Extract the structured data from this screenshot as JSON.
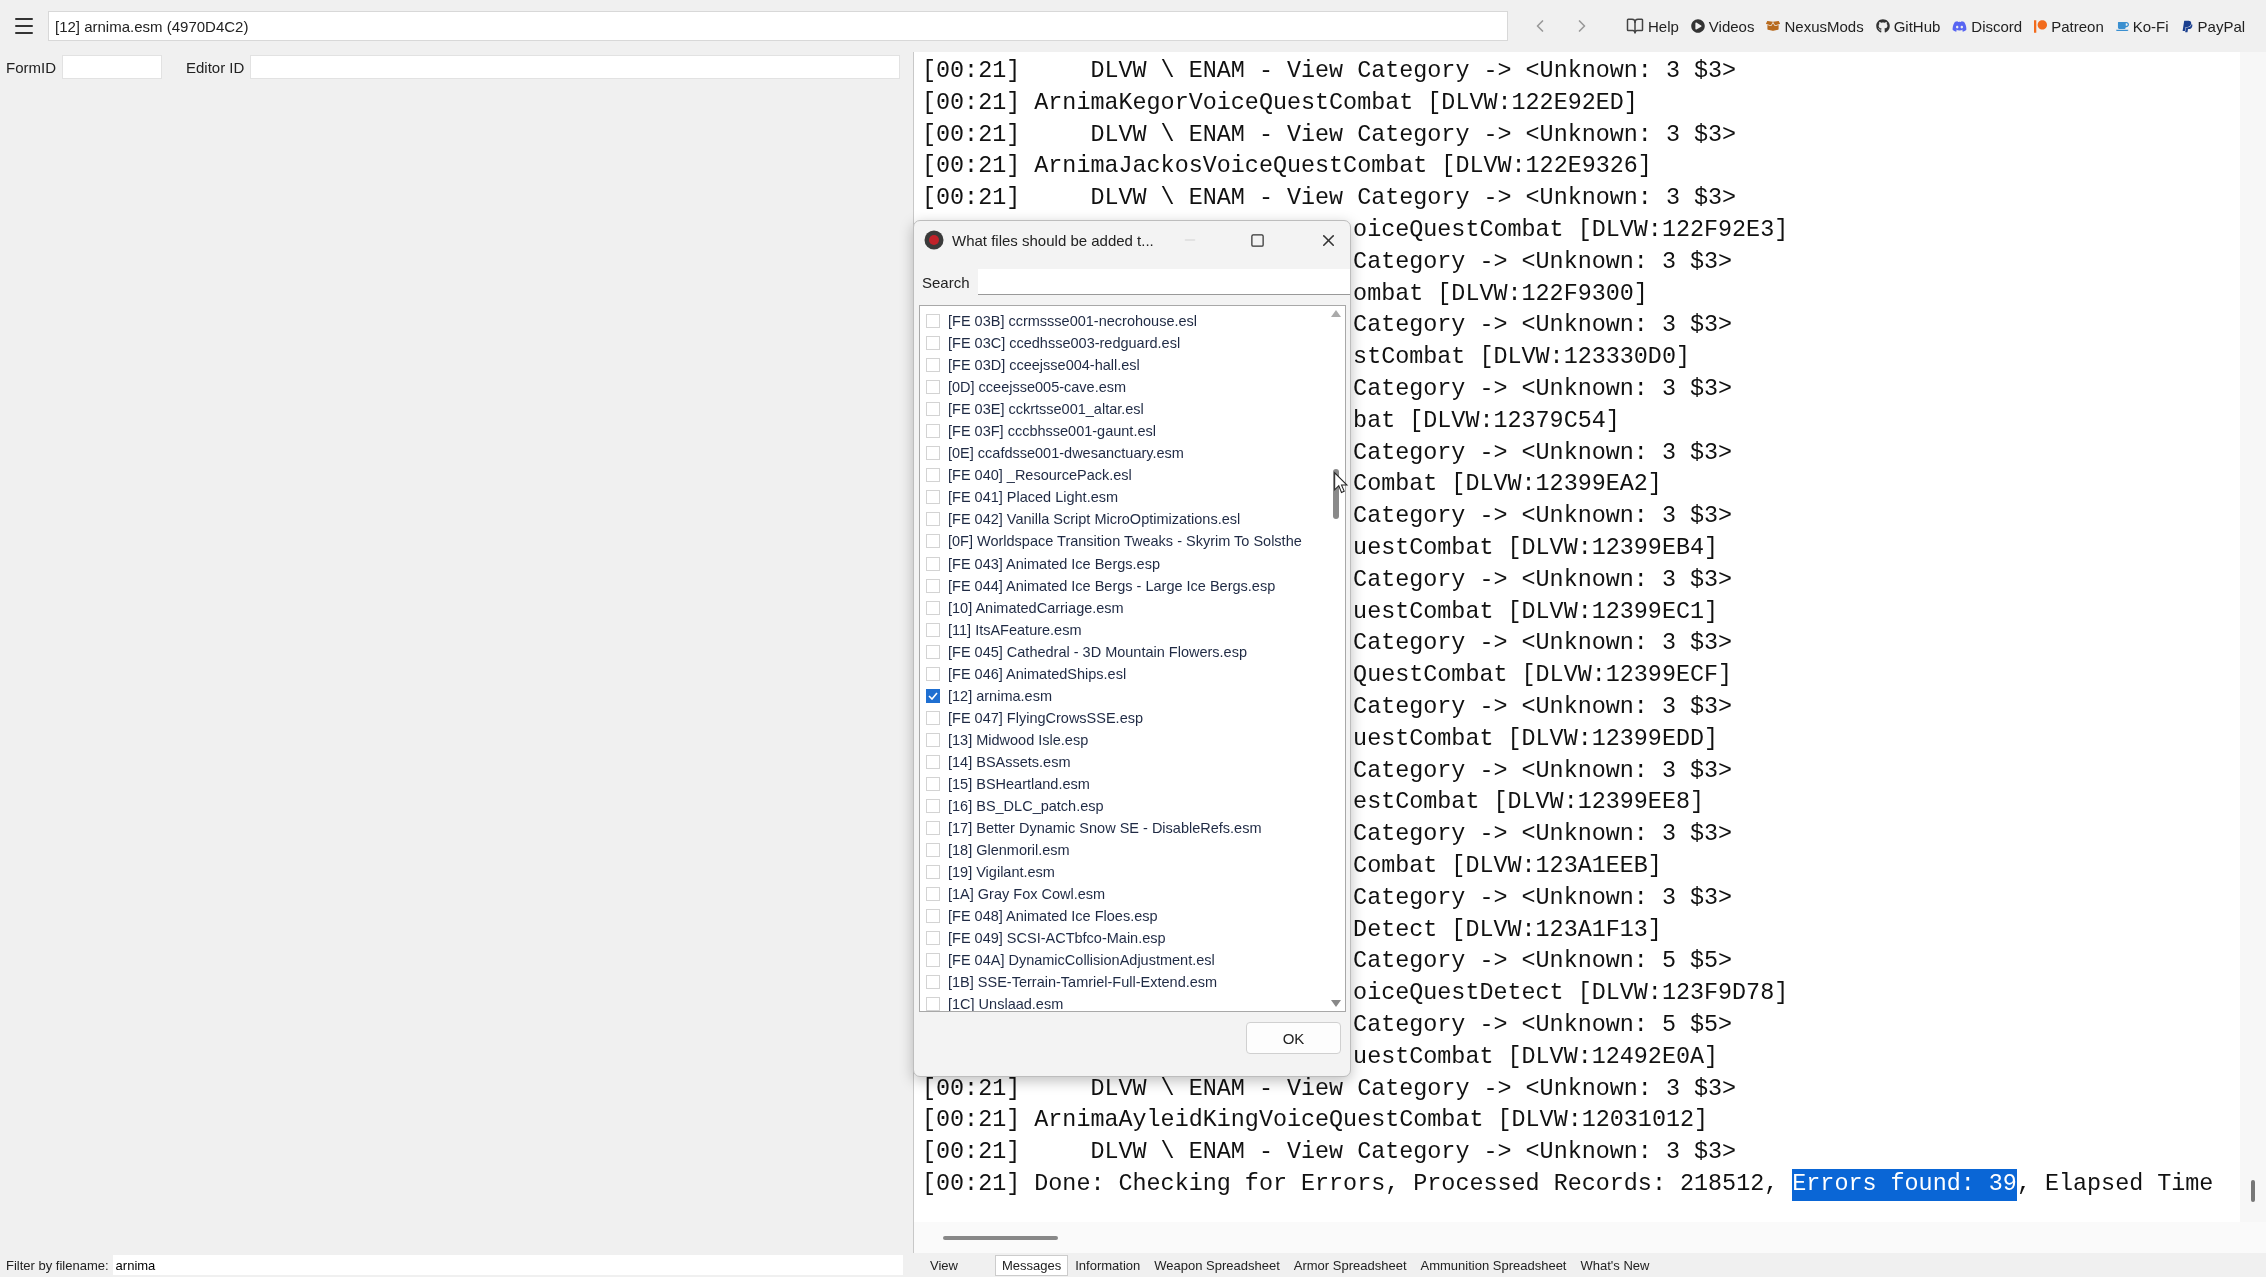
{
  "toolbar": {
    "record": "[12] arnima.esm (4970D4C2)",
    "links": [
      {
        "label": "Help",
        "kind": "book"
      },
      {
        "label": "Videos",
        "kind": "play"
      },
      {
        "label": "NexusMods",
        "kind": "box"
      },
      {
        "label": "GitHub",
        "kind": "github"
      },
      {
        "label": "Discord",
        "kind": "discord"
      },
      {
        "label": "Patreon",
        "kind": "patreon"
      },
      {
        "label": "Ko-Fi",
        "kind": "kofi"
      },
      {
        "label": "PayPal",
        "kind": "paypal"
      }
    ]
  },
  "filters": {
    "form_id_label": "FormID",
    "editor_id_label": "Editor ID"
  },
  "log": {
    "lines": [
      {
        "text": "[00:21]     DLVW \\ ENAM - View Category -> <Unknown: 3 $3>",
        "behind_dialog": false
      },
      {
        "text": "[00:21] ArnimaKegorVoiceQuestCombat [DLVW:122E92ED]",
        "behind_dialog": false
      },
      {
        "text": "[00:21]     DLVW \\ ENAM - View Category -> <Unknown: 3 $3>",
        "behind_dialog": false
      },
      {
        "text": "[00:21] ArnimaJackosVoiceQuestCombat [DLVW:122E9326]",
        "behind_dialog": false
      },
      {
        "text": "[00:21]     DLVW \\ ENAM - View Category -> <Unknown: 3 $3>",
        "behind_dialog": false
      },
      {
        "text": "oiceQuestCombat [DLVW:122F92E3]",
        "behind_dialog": true
      },
      {
        "text": "Category -> <Unknown: 3 $3>",
        "behind_dialog": true
      },
      {
        "text": "ombat [DLVW:122F9300]",
        "behind_dialog": true
      },
      {
        "text": "Category -> <Unknown: 3 $3>",
        "behind_dialog": true
      },
      {
        "text": "stCombat [DLVW:123330D0]",
        "behind_dialog": true
      },
      {
        "text": "Category -> <Unknown: 3 $3>",
        "behind_dialog": true
      },
      {
        "text": "bat [DLVW:12379C54]",
        "behind_dialog": true
      },
      {
        "text": "Category -> <Unknown: 3 $3>",
        "behind_dialog": true
      },
      {
        "text": "Combat [DLVW:12399EA2]",
        "behind_dialog": true
      },
      {
        "text": "Category -> <Unknown: 3 $3>",
        "behind_dialog": true
      },
      {
        "text": "uestCombat [DLVW:12399EB4]",
        "behind_dialog": true
      },
      {
        "text": "Category -> <Unknown: 3 $3>",
        "behind_dialog": true
      },
      {
        "text": "uestCombat [DLVW:12399EC1]",
        "behind_dialog": true
      },
      {
        "text": "Category -> <Unknown: 3 $3>",
        "behind_dialog": true
      },
      {
        "text": "QuestCombat [DLVW:12399ECF]",
        "behind_dialog": true
      },
      {
        "text": "Category -> <Unknown: 3 $3>",
        "behind_dialog": true
      },
      {
        "text": "uestCombat [DLVW:12399EDD]",
        "behind_dialog": true
      },
      {
        "text": "Category -> <Unknown: 3 $3>",
        "behind_dialog": true
      },
      {
        "text": "estCombat [DLVW:12399EE8]",
        "behind_dialog": true
      },
      {
        "text": "Category -> <Unknown: 3 $3>",
        "behind_dialog": true
      },
      {
        "text": "Combat [DLVW:123A1EEB]",
        "behind_dialog": true
      },
      {
        "text": "Category -> <Unknown: 3 $3>",
        "behind_dialog": true
      },
      {
        "text": "Detect [DLVW:123A1F13]",
        "behind_dialog": true
      },
      {
        "text": "Category -> <Unknown: 5 $5>",
        "behind_dialog": true
      },
      {
        "text": "oiceQuestDetect [DLVW:123F9D78]",
        "behind_dialog": true
      },
      {
        "text": "Category -> <Unknown: 5 $5>",
        "behind_dialog": true
      },
      {
        "text": "uestCombat [DLVW:12492E0A]",
        "behind_dialog": true
      },
      {
        "text": "[00:21]     DLVW \\ ENAM - View Category -> <Unknown: 3 $3>",
        "behind_dialog": false
      },
      {
        "text": "[00:21] ArnimaAyleidKingVoiceQuestCombat [DLVW:12031012]",
        "behind_dialog": false
      },
      {
        "text": "[00:21]     DLVW \\ ENAM - View Category -> <Unknown: 3 $3>",
        "behind_dialog": false
      }
    ],
    "summary": [
      {
        "text": "[00:21] Done: Checking for Errors, Processed Records: 218512,",
        "selected": false
      },
      {
        "text": "Errors found: 39",
        "selected": true
      },
      {
        "text": ", Elapsed Time",
        "selected": false
      }
    ]
  },
  "bottom": {
    "filter_label": "Filter by filename:",
    "filter_value": "arnima",
    "tabs": [
      {
        "label": "View",
        "selected": false
      },
      {
        "label": "Messages",
        "selected": true
      },
      {
        "label": "Information",
        "selected": false
      },
      {
        "label": "Weapon Spreadsheet",
        "selected": false
      },
      {
        "label": "Armor Spreadsheet",
        "selected": false
      },
      {
        "label": "Ammunition Spreadsheet",
        "selected": false
      },
      {
        "label": "What's New",
        "selected": false
      }
    ]
  },
  "dialog": {
    "title": "What files should be added t...",
    "search_label": "Search",
    "ok": "OK",
    "files": [
      {
        "label": "[FE 03B] ccrmssse001-necrohouse.esl",
        "checked": false
      },
      {
        "label": "[FE 03C] ccedhsse003-redguard.esl",
        "checked": false
      },
      {
        "label": "[FE 03D] cceejsse004-hall.esl",
        "checked": false
      },
      {
        "label": "[0D] cceejsse005-cave.esm",
        "checked": false
      },
      {
        "label": "[FE 03E] cckrtsse001_altar.esl",
        "checked": false
      },
      {
        "label": "[FE 03F] cccbhsse001-gaunt.esl",
        "checked": false
      },
      {
        "label": "[0E] ccafdsse001-dwesanctuary.esm",
        "checked": false
      },
      {
        "label": "[FE 040] _ResourcePack.esl",
        "checked": false
      },
      {
        "label": "[FE 041] Placed Light.esm",
        "checked": false
      },
      {
        "label": "[FE 042] Vanilla Script MicroOptimizations.esl",
        "checked": false
      },
      {
        "label": "[0F] Worldspace Transition Tweaks - Skyrim To Solsthe",
        "checked": false
      },
      {
        "label": "[FE 043] Animated Ice Bergs.esp",
        "checked": false
      },
      {
        "label": "[FE 044] Animated Ice Bergs - Large Ice Bergs.esp",
        "checked": false
      },
      {
        "label": "[10] AnimatedCarriage.esm",
        "checked": false
      },
      {
        "label": "[11] ItsAFeature.esm",
        "checked": false
      },
      {
        "label": "[FE 045] Cathedral - 3D Mountain Flowers.esp",
        "checked": false
      },
      {
        "label": "[FE 046] AnimatedShips.esl",
        "checked": false
      },
      {
        "label": "[12] arnima.esm",
        "checked": true
      },
      {
        "label": "[FE 047] FlyingCrowsSSE.esp",
        "checked": false
      },
      {
        "label": "[13] Midwood Isle.esp",
        "checked": false
      },
      {
        "label": "[14] BSAssets.esm",
        "checked": false
      },
      {
        "label": "[15] BSHeartland.esm",
        "checked": false
      },
      {
        "label": "[16] BS_DLC_patch.esp",
        "checked": false
      },
      {
        "label": "[17] Better Dynamic Snow SE - DisableRefs.esm",
        "checked": false
      },
      {
        "label": "[18] Glenmoril.esm",
        "checked": false
      },
      {
        "label": "[19] Vigilant.esm",
        "checked": false
      },
      {
        "label": "[1A] Gray Fox Cowl.esm",
        "checked": false
      },
      {
        "label": "[FE 048] Animated Ice Floes.esp",
        "checked": false
      },
      {
        "label": "[FE 049] SCSI-ACTbfco-Main.esp",
        "checked": false
      },
      {
        "label": "[FE 04A] DynamicCollisionAdjustment.esl",
        "checked": false
      },
      {
        "label": "[1B] SSE-Terrain-Tamriel-Full-Extend.esm",
        "checked": false
      },
      {
        "label": "[1C] Unslaad.esm",
        "checked": false
      }
    ]
  }
}
